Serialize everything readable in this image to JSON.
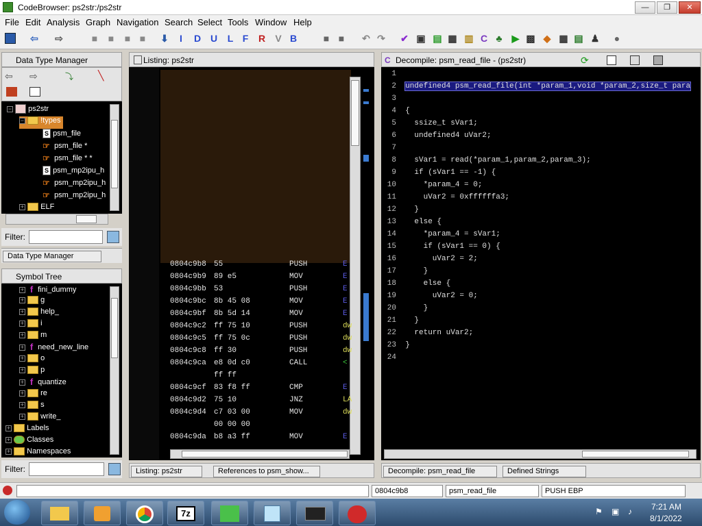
{
  "window": {
    "title": "CodeBrowser: ps2str:/ps2str",
    "minimize": "—",
    "maximize": "❐",
    "close": "✕"
  },
  "menu": [
    "File",
    "Edit",
    "Analysis",
    "Graph",
    "Navigation",
    "Search",
    "Select",
    "Tools",
    "Window",
    "Help"
  ],
  "toolbar": {
    "letters": [
      "I",
      "D",
      "U",
      "L",
      "F",
      "R",
      "V",
      "B"
    ]
  },
  "dtm": {
    "title": "Data Type Manager",
    "root": "ps2str",
    "items": [
      {
        "label": "!types",
        "kind": "folder"
      },
      {
        "label": "psm_file",
        "kind": "struct"
      },
      {
        "label": "psm_file *",
        "kind": "pointer"
      },
      {
        "label": "psm_file * *",
        "kind": "pointer"
      },
      {
        "label": "psm_mp2ipu_h",
        "kind": "struct"
      },
      {
        "label": "psm_mp2ipu_h",
        "kind": "pointer"
      },
      {
        "label": "psm_mp2ipu_h",
        "kind": "pointer"
      },
      {
        "label": "ELF",
        "kind": "folder"
      }
    ],
    "filter_label": "Filter:",
    "tab": "Data Type Manager"
  },
  "symtree": {
    "title": "Symbol Tree",
    "items": [
      {
        "label": "fini_dummy",
        "kind": "fn"
      },
      {
        "label": "g",
        "kind": "folder"
      },
      {
        "label": "help_",
        "kind": "folder"
      },
      {
        "label": "i",
        "kind": "folder"
      },
      {
        "label": "m",
        "kind": "folder"
      },
      {
        "label": "need_new_line",
        "kind": "fn"
      },
      {
        "label": "o",
        "kind": "folder"
      },
      {
        "label": "p",
        "kind": "folder"
      },
      {
        "label": "quantize",
        "kind": "fn"
      },
      {
        "label": "re",
        "kind": "folder"
      },
      {
        "label": "s",
        "kind": "folder"
      },
      {
        "label": "write_",
        "kind": "folder"
      },
      {
        "label": "Labels",
        "kind": "folder"
      },
      {
        "label": "Classes",
        "kind": "folder"
      },
      {
        "label": "Namespaces",
        "kind": "folder"
      }
    ],
    "filter_label": "Filter:"
  },
  "listing": {
    "title": "Listing:  ps2str",
    "rows": [
      {
        "addr": "0804c9b8",
        "bytes": "55",
        "mnem": "PUSH",
        "op": "E"
      },
      {
        "addr": "0804c9b9",
        "bytes": "89 e5",
        "mnem": "MOV",
        "op": "E"
      },
      {
        "addr": "0804c9bb",
        "bytes": "53",
        "mnem": "PUSH",
        "op": "E"
      },
      {
        "addr": "0804c9bc",
        "bytes": "8b 45 08",
        "mnem": "MOV",
        "op": "E"
      },
      {
        "addr": "0804c9bf",
        "bytes": "8b 5d 14",
        "mnem": "MOV",
        "op": "E"
      },
      {
        "addr": "0804c9c2",
        "bytes": "ff 75 10",
        "mnem": "PUSH",
        "op": "dw"
      },
      {
        "addr": "0804c9c5",
        "bytes": "ff 75 0c",
        "mnem": "PUSH",
        "op": "dw"
      },
      {
        "addr": "0804c9c8",
        "bytes": "ff 30",
        "mnem": "PUSH",
        "op": "dw"
      },
      {
        "addr": "0804c9ca",
        "bytes": "e8 0d c0",
        "mnem": "CALL",
        "op": "<"
      },
      {
        "addr": "",
        "bytes": "ff ff",
        "mnem": "",
        "op": ""
      },
      {
        "addr": "0804c9cf",
        "bytes": "83 f8 ff",
        "mnem": "CMP",
        "op": "E"
      },
      {
        "addr": "0804c9d2",
        "bytes": "75 10",
        "mnem": "JNZ",
        "op": "LA"
      },
      {
        "addr": "0804c9d4",
        "bytes": "c7 03 00",
        "mnem": "MOV",
        "op": "dw"
      },
      {
        "addr": "",
        "bytes": "00 00 00",
        "mnem": "",
        "op": ""
      },
      {
        "addr": "0804c9da",
        "bytes": "b8 a3 ff",
        "mnem": "MOV",
        "op": "E"
      }
    ],
    "tabs": [
      "Listing:  ps2str",
      "References to psm_show..."
    ]
  },
  "decompile": {
    "title": "Decompile: psm_read_file -  (ps2str)",
    "lines": [
      {
        "n": "1",
        "t": ""
      },
      {
        "n": "2",
        "t": "undefined4 psm_read_file(int *param_1,void *param_2,size_t para"
      },
      {
        "n": "3",
        "t": ""
      },
      {
        "n": "4",
        "t": "{"
      },
      {
        "n": "5",
        "t": "  ssize_t sVar1;"
      },
      {
        "n": "6",
        "t": "  undefined4 uVar2;"
      },
      {
        "n": "7",
        "t": ""
      },
      {
        "n": "8",
        "t": "  sVar1 = read(*param_1,param_2,param_3);"
      },
      {
        "n": "9",
        "t": "  if (sVar1 == -1) {"
      },
      {
        "n": "10",
        "t": "    *param_4 = 0;"
      },
      {
        "n": "11",
        "t": "    uVar2 = 0xffffffa3;"
      },
      {
        "n": "12",
        "t": "  }"
      },
      {
        "n": "13",
        "t": "  else {"
      },
      {
        "n": "14",
        "t": "    *param_4 = sVar1;"
      },
      {
        "n": "15",
        "t": "    if (sVar1 == 0) {"
      },
      {
        "n": "16",
        "t": "      uVar2 = 2;"
      },
      {
        "n": "17",
        "t": "    }"
      },
      {
        "n": "18",
        "t": "    else {"
      },
      {
        "n": "19",
        "t": "      uVar2 = 0;"
      },
      {
        "n": "20",
        "t": "    }"
      },
      {
        "n": "21",
        "t": "  }"
      },
      {
        "n": "22",
        "t": "  return uVar2;"
      },
      {
        "n": "23",
        "t": "}"
      },
      {
        "n": "24",
        "t": ""
      }
    ],
    "tabs": [
      "Decompile: psm_read_file",
      "Defined Strings"
    ]
  },
  "status": {
    "address": "0804c9b8",
    "function": "psm_read_file",
    "instruction": "PUSH EBP"
  },
  "taskbar": {
    "time": "7:21 AM",
    "date": "8/1/2022"
  }
}
